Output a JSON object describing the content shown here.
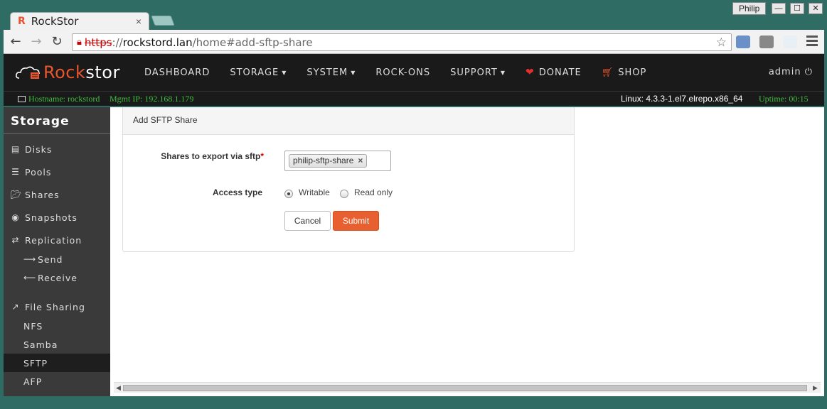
{
  "browser": {
    "tab_favicon": "R",
    "tab_title": "RockStor",
    "tab_close": "×",
    "profile": "Philip",
    "win_min": "—",
    "win_max": "☐",
    "win_close": "✕",
    "url_scheme": "https",
    "url_sep": "://",
    "url_host": "rockstord.lan",
    "url_path": "/home#add-sftp-share"
  },
  "header": {
    "logo_prefix": "Rock",
    "logo_suffix": "stor",
    "nav": [
      "DASHBOARD",
      "STORAGE",
      "SYSTEM",
      "ROCK-ONS",
      "SUPPORT",
      "DONATE",
      "SHOP"
    ],
    "user": "admin"
  },
  "status": {
    "hostname": "Hostname: rockstord",
    "mgmt_ip": "Mgmt IP: 192.168.1.179",
    "kernel": "Linux: 4.3.3-1.el7.elrepo.x86_64",
    "uptime": "Uptime: 00:15"
  },
  "sidebar": {
    "title": "Storage",
    "items": [
      "Disks",
      "Pools",
      "Shares",
      "Snapshots",
      "Replication",
      "Send",
      "Receive",
      "File Sharing",
      "NFS",
      "Samba",
      "SFTP",
      "AFP"
    ],
    "active": "SFTP"
  },
  "form": {
    "panel_title": "Add SFTP Share",
    "shares_label": "Shares to export via sftp",
    "required_mark": "*",
    "selected_share": "philip-sftp-share",
    "access_label": "Access type",
    "access_options": [
      "Writable",
      "Read only"
    ],
    "access_selected": "Writable",
    "cancel": "Cancel",
    "submit": "Submit"
  },
  "colors": {
    "brand": "#e8552e",
    "status_green": "#3fbf3f",
    "submit": "#e8602f"
  }
}
